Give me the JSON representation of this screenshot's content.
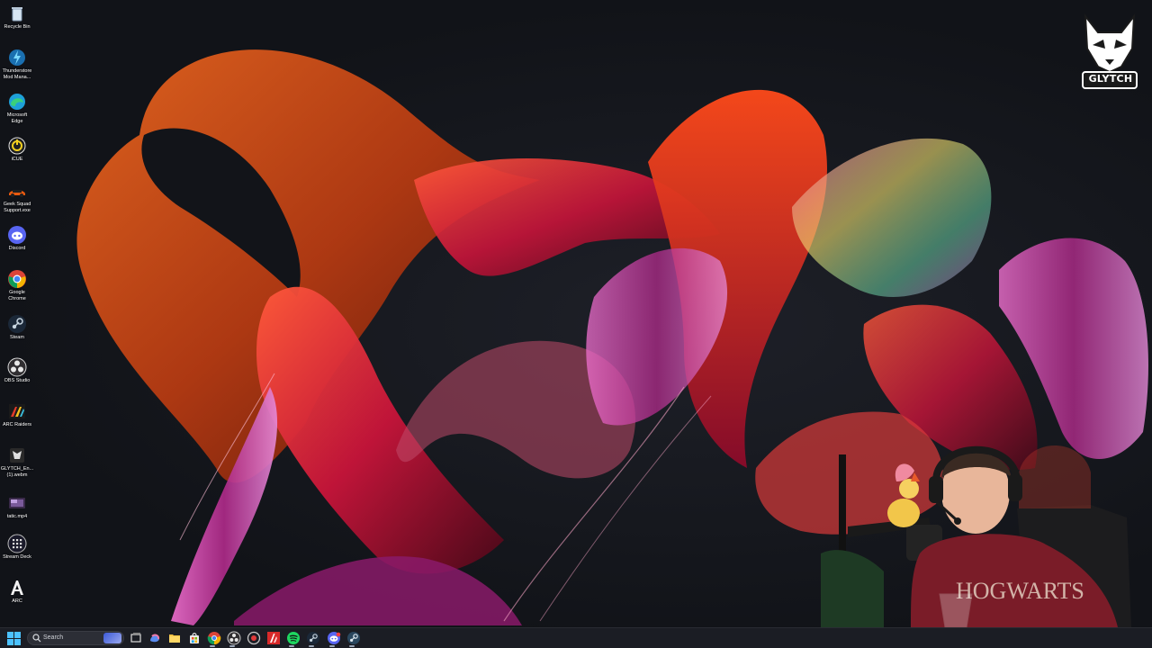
{
  "desktop": {
    "icons": [
      {
        "label": "Recycle Bin",
        "icon": "recycle-bin-icon"
      },
      {
        "label": "Thunderstore\nMod Mana...",
        "icon": "thunderstore-icon"
      },
      {
        "label": "Microsoft\nEdge",
        "icon": "edge-icon"
      },
      {
        "label": "iCUE",
        "icon": "icue-icon"
      },
      {
        "label": "Geek Squad\nSupport.exe",
        "icon": "geek-squad-icon"
      },
      {
        "label": "Discord",
        "icon": "discord-icon"
      },
      {
        "label": "Google\nChrome",
        "icon": "chrome-icon"
      },
      {
        "label": "Steam",
        "icon": "steam-icon"
      },
      {
        "label": "OBS Studio",
        "icon": "obs-icon"
      },
      {
        "label": "ARC Raiders",
        "icon": "arc-raiders-icon"
      },
      {
        "label": "GLYTCH_En...\n(1).webm",
        "icon": "video-file-icon"
      },
      {
        "label": "tatic.mp4",
        "icon": "video-file-icon"
      },
      {
        "label": "Stream Deck",
        "icon": "stream-deck-icon"
      },
      {
        "label": "ARC",
        "icon": "arc-icon"
      }
    ]
  },
  "overlay": {
    "logo_text": "GLYTCH",
    "logo_icon": "fox-head-icon"
  },
  "taskbar": {
    "search_placeholder": "Search",
    "start_icon": "windows-start-icon",
    "apps": [
      "task-view-icon",
      "copilot-icon",
      "file-explorer-icon",
      "store-icon",
      "chrome-icon",
      "obs-icon",
      "recording-icon",
      "arc-raiders-icon",
      "spotify-icon",
      "steam-icon",
      "discord-icon",
      "steam-icon"
    ]
  },
  "colors": {
    "accent": "#0a84ff",
    "taskbar": "#1c1e24",
    "ribbon_orange": "#e25a1c",
    "ribbon_red": "#c8143a",
    "ribbon_magenta": "#c0309a"
  }
}
